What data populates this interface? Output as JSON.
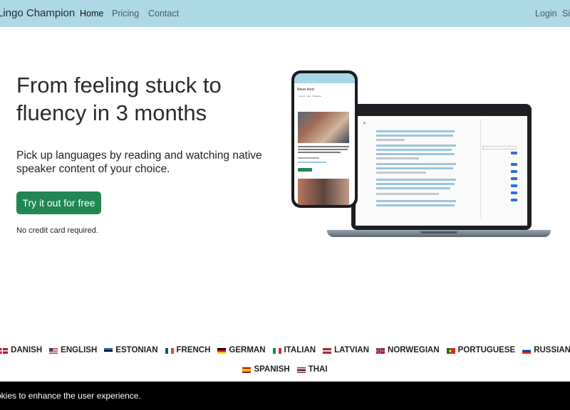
{
  "nav": {
    "brand": "Lingo Champion",
    "links": [
      {
        "label": "Home",
        "active": true
      },
      {
        "label": "Pricing",
        "active": false
      },
      {
        "label": "Contact",
        "active": false
      }
    ],
    "login": "Login",
    "signup": "Sig"
  },
  "hero": {
    "title_line1": "From feeling stuck to",
    "title_line2": "fluency in 3 months",
    "subtitle": "Pick up languages by reading and watching native speaker content of your choice.",
    "cta": "Try it out for free",
    "note": "No credit card required."
  },
  "mockup": {
    "phone_feed_title": "News feed",
    "phone_article_title": "Más problemas para Pellegrino: las lujas que tendrá fuera clásico universitario ante la UC · La Tercera",
    "phone_button": "Read it now"
  },
  "languages": [
    {
      "name": "DANISH",
      "flag": "dk"
    },
    {
      "name": "ENGLISH",
      "flag": "us"
    },
    {
      "name": "ESTONIAN",
      "flag": "ee"
    },
    {
      "name": "FRENCH",
      "flag": "fr"
    },
    {
      "name": "GERMAN",
      "flag": "de"
    },
    {
      "name": "ITALIAN",
      "flag": "it"
    },
    {
      "name": "LATVIAN",
      "flag": "lv"
    },
    {
      "name": "NORWEGIAN",
      "flag": "no"
    },
    {
      "name": "PORTUGUESE",
      "flag": "pt"
    },
    {
      "name": "RUSSIAN",
      "flag": "ru"
    },
    {
      "name": "SPANISH",
      "flag": "es"
    },
    {
      "name": "THAI",
      "flag": "th"
    }
  ],
  "cookie": {
    "text": "okies to enhance the user experience."
  },
  "colors": {
    "navbar": "#add8e6",
    "cta": "#218752",
    "cookie_bar": "#000000"
  }
}
